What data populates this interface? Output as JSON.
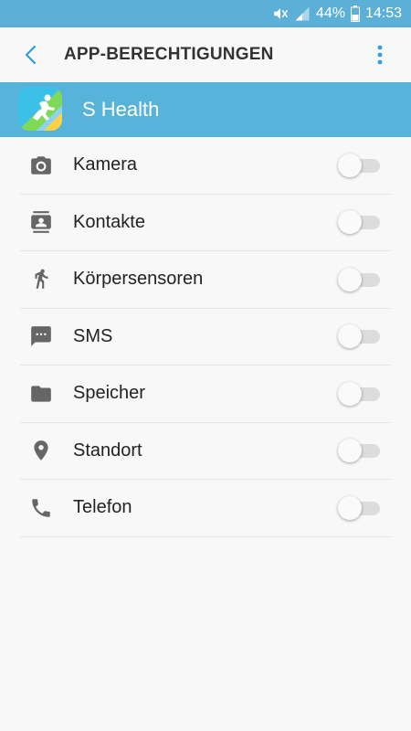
{
  "status_bar": {
    "battery_percent": "44%",
    "time": "14:53",
    "icons": [
      "mute-icon",
      "signal-icon",
      "battery-icon"
    ]
  },
  "app_bar": {
    "title": "APP-BERECHTIGUNGEN",
    "back_icon": "back-arrow-icon",
    "more_icon": "more-vert-icon"
  },
  "app": {
    "name": "S Health",
    "icon": "s-health-icon"
  },
  "permissions": [
    {
      "label": "Kamera",
      "icon": "camera-icon",
      "enabled": false
    },
    {
      "label": "Kontakte",
      "icon": "contacts-icon",
      "enabled": false
    },
    {
      "label": "Körpersensoren",
      "icon": "body-sensors-icon",
      "enabled": false
    },
    {
      "label": "SMS",
      "icon": "sms-icon",
      "enabled": false
    },
    {
      "label": "Speicher",
      "icon": "folder-icon",
      "enabled": false
    },
    {
      "label": "Standort",
      "icon": "location-icon",
      "enabled": false
    },
    {
      "label": "Telefon",
      "icon": "phone-icon",
      "enabled": false
    }
  ],
  "colors": {
    "status_bar": "#5cafd6",
    "app_header": "#57b3d9",
    "accent": "#2d9ed8",
    "icon_grey": "#666666"
  }
}
